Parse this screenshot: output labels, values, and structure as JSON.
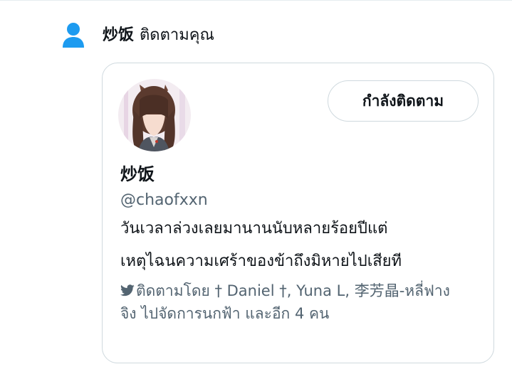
{
  "notification": {
    "actor_name": "炒饭",
    "action_text": "ติดตามคุณ",
    "icon": "person-icon",
    "icon_color": "#1d9bf0"
  },
  "profile_card": {
    "avatar": "avatar-image",
    "follow_button_label": "กำลังติดตาม",
    "display_name": "炒饭",
    "handle": "@chaofxxn",
    "bio_lines": [
      "วันเวลาล่วงเลยมานานนับหลายร้อยปีแต่",
      "เหตุไฉนความเศร้าของข้าถึงมิหายไปเสียที"
    ],
    "followed_by_icon": "bird-icon",
    "followed_by_text": "ติดตามโดย † Daniel †, Yuna L, 李芳晶-หลี่ฟางจิง ไปจัดการนกฟ้า และอีก 4 คน"
  },
  "colors": {
    "accent": "#1d9bf0",
    "text_primary": "#0f1419",
    "text_secondary": "#536471",
    "border": "#cfd9de"
  }
}
